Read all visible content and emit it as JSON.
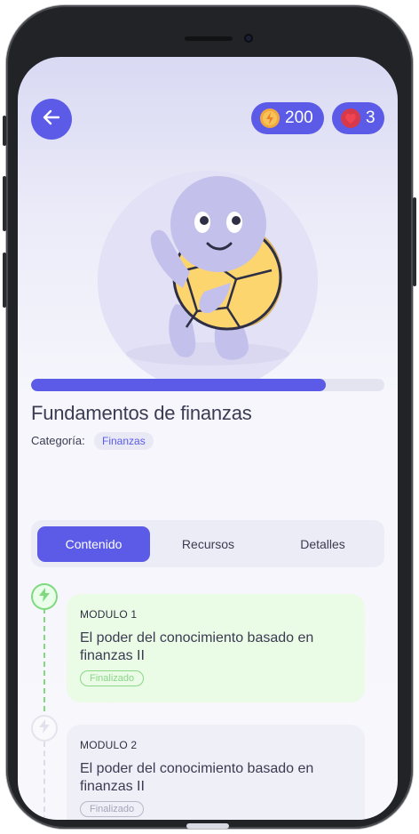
{
  "header": {
    "coins": "200",
    "lives": "3"
  },
  "course": {
    "title": "Fundamentos de finanzas",
    "category_label": "Categoría:",
    "category": "Finanzas",
    "progress": 0.835
  },
  "tabs": [
    {
      "label": "Contenido",
      "active": true
    },
    {
      "label": "Recursos",
      "active": false
    },
    {
      "label": "Detalles",
      "active": false
    }
  ],
  "modules": [
    {
      "module": "MODULO 1",
      "title": "El poder del conocimiento basado en finanzas II",
      "status": "Finalizado",
      "state": "done"
    },
    {
      "module": "MODULO 2",
      "title": "El poder del conocimiento basado en finanzas II",
      "status": "Finalizado",
      "state": "todo"
    }
  ],
  "colors": {
    "accent": "#5b5be8",
    "done_green": "#7fda7f",
    "title_text": "#3b3b52"
  },
  "icons": {
    "back": "arrow-left-icon",
    "coin": "coin-icon",
    "heart": "heart-icon",
    "node": "lightning-icon"
  }
}
